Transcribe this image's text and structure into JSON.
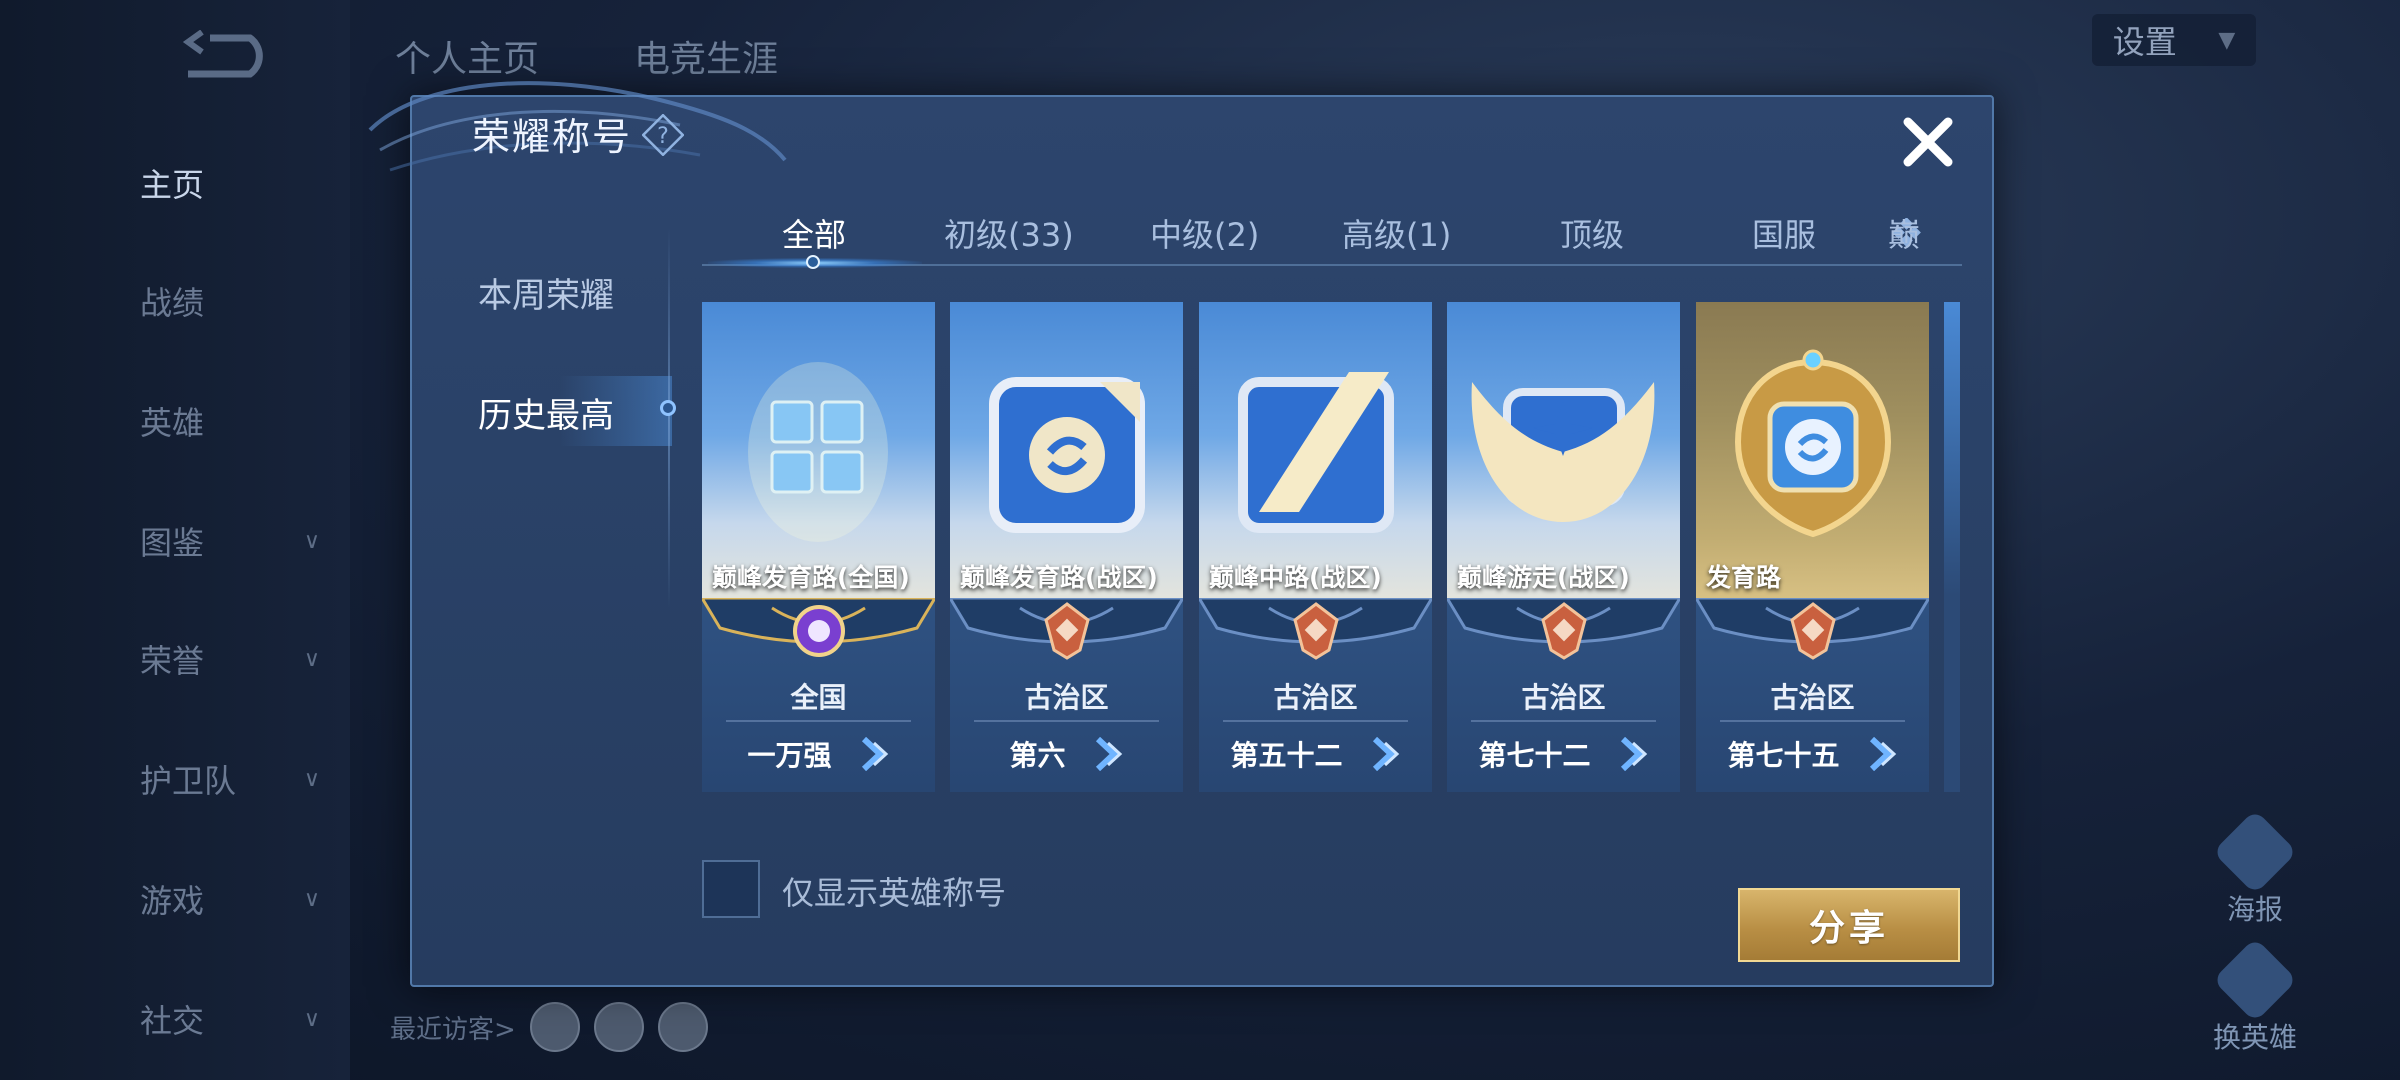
{
  "background": {
    "top_tabs": [
      "个人主页",
      "电竞生涯"
    ],
    "nav_items": [
      {
        "label": "主页",
        "has_chevron": false,
        "active": true
      },
      {
        "label": "战绩",
        "has_chevron": false,
        "active": false
      },
      {
        "label": "英雄",
        "has_chevron": false,
        "active": false
      },
      {
        "label": "图鉴",
        "has_chevron": true,
        "active": false
      },
      {
        "label": "荣誉",
        "has_chevron": true,
        "active": false
      },
      {
        "label": "护卫队",
        "has_chevron": true,
        "active": false
      },
      {
        "label": "游戏",
        "has_chevron": true,
        "active": false
      },
      {
        "label": "社交",
        "has_chevron": true,
        "active": false
      }
    ],
    "settings_label": "设置",
    "recent_visitors_label": "最近访客>",
    "right_actions": [
      {
        "label": "海报",
        "icon": "poster-icon"
      },
      {
        "label": "换英雄",
        "icon": "swap-hero-icon"
      }
    ]
  },
  "modal": {
    "title": "荣耀称号",
    "side_tabs": [
      {
        "label": "本周荣耀",
        "active": false
      },
      {
        "label": "历史最高",
        "active": true
      }
    ],
    "tabs": [
      {
        "label": "全部",
        "active": true
      },
      {
        "label": "初级(33)",
        "active": false
      },
      {
        "label": "中级(2)",
        "active": false
      },
      {
        "label": "高级(1)",
        "active": false
      },
      {
        "label": "顶级",
        "active": false
      },
      {
        "label": "国服",
        "active": false
      },
      {
        "label": "巅",
        "active": false
      }
    ],
    "cards": [
      {
        "title": "巅峰发育路(全国)",
        "region": "全国",
        "rank": "一万强",
        "art": "blue",
        "emblem": "glowing-grid-emblem"
      },
      {
        "title": "巅峰发育路(战区)",
        "region": "古治区",
        "rank": "第六",
        "art": "blue",
        "emblem": "s-badge-emblem"
      },
      {
        "title": "巅峰中路(战区)",
        "region": "古治区",
        "rank": "第五十二",
        "art": "blue",
        "emblem": "slash-frame-emblem"
      },
      {
        "title": "巅峰游走(战区)",
        "region": "古治区",
        "rank": "第七十二",
        "art": "blue",
        "emblem": "winged-emblem"
      },
      {
        "title": "发育路",
        "region": "古治区",
        "rank": "第七十五",
        "art": "gold",
        "emblem": "gold-medal-emblem"
      }
    ],
    "checkbox_label": "仅显示英雄称号",
    "checkbox_checked": false,
    "share_label": "分享"
  },
  "colors": {
    "accent_blue": "#5aa9ff",
    "panel_bg": "#2a4268",
    "gold": "#c9a45a"
  }
}
